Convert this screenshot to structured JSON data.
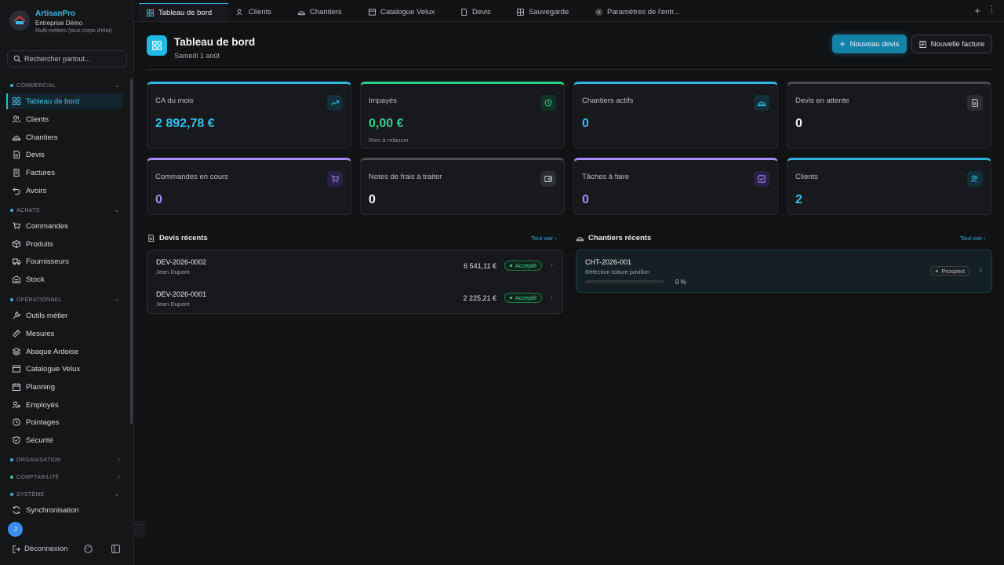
{
  "brand": {
    "name": "ArtisanPro",
    "company": "Entreprise Démo",
    "trade": "Multi-métiers (tous corps d'état)"
  },
  "search": {
    "placeholder": "Rechercher partout..."
  },
  "sidebar": {
    "sections": {
      "commercial": "COMMERCIAL",
      "achats": "ACHATS",
      "operationnel": "OPÉRATIONNEL",
      "organisation": "ORGANISATION",
      "comptabilite": "COMPTABILITÉ",
      "systeme": "SYSTÈME"
    },
    "items": {
      "tableau": "Tableau de bord",
      "clients": "Clients",
      "chantiers": "Chantiers",
      "devis": "Devis",
      "factures": "Factures",
      "avoirs": "Avoirs",
      "commandes": "Commandes",
      "produits": "Produits",
      "fournisseurs": "Fournisseurs",
      "stock": "Stock",
      "outils": "Outils métier",
      "mesures": "Mesures",
      "abaque": "Abaque Ardoise",
      "velux": "Catalogue Velux",
      "planning": "Planning",
      "employes": "Employés",
      "pointages": "Pointages",
      "securite": "Sécurité",
      "sync": "Synchronisation"
    },
    "avatar_initial": "J",
    "logout": "Déconnexion"
  },
  "tabs": {
    "tableau": "Tableau de bord",
    "clients": "Clients",
    "chantiers": "Chantiers",
    "velux": "Catalogue Velux",
    "devis": "Devis",
    "sauvegarde": "Sauvegarde",
    "parametres": "Paramètres de l'entr..."
  },
  "header": {
    "title": "Tableau de bord",
    "date": "Samedi 1 août",
    "new_quote": "Nouveau devis",
    "new_invoice": "Nouvelle facture"
  },
  "stats": {
    "ca": {
      "label": "CA du mois",
      "value": "2 892,78 €"
    },
    "impayes": {
      "label": "Impayés",
      "value": "0,00 €",
      "note": "Rien à relancer"
    },
    "chantiers": {
      "label": "Chantiers actifs",
      "value": "0"
    },
    "devis_attente": {
      "label": "Devis en attente",
      "value": "0"
    },
    "commandes": {
      "label": "Commandes en cours",
      "value": "0"
    },
    "notes_frais": {
      "label": "Notes de frais à traiter",
      "value": "0"
    },
    "taches": {
      "label": "Tâches à faire",
      "value": "0"
    },
    "clients": {
      "label": "Clients",
      "value": "2"
    }
  },
  "colors": {
    "accent": "#2fb3e0",
    "green": "#2fcf8a",
    "purple": "#a78bfa",
    "gray": "#4a4d52"
  },
  "recent_quotes": {
    "title": "Devis récents",
    "see_all": "Tout voir ›",
    "rows": [
      {
        "ref": "DEV-2026-0002",
        "client": "Jean Dupont",
        "amount": "6 541,11 €",
        "status": "Accepté"
      },
      {
        "ref": "DEV-2026-0001",
        "client": "Jean Dupont",
        "amount": "2 225,21 €",
        "status": "Accepté"
      }
    ]
  },
  "recent_sites": {
    "title": "Chantiers récents",
    "see_all": "Tout voir ›",
    "rows": [
      {
        "ref": "CHT-2026-001",
        "desc": "Réfection toiture pavillon",
        "progress": 0,
        "progress_label": "0 %",
        "status": "Prospect"
      }
    ]
  }
}
